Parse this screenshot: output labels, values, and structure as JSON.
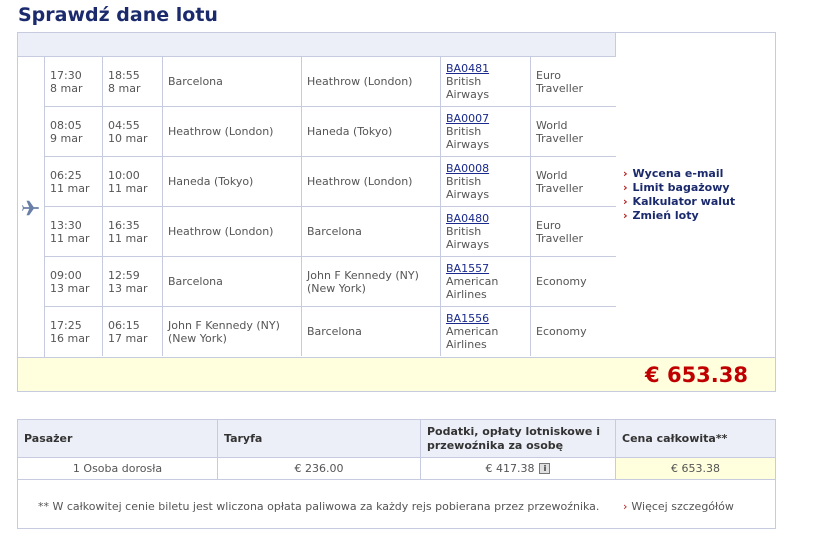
{
  "page_title": "Sprawdź dane lotu",
  "flights": [
    {
      "dep_time": "17:30",
      "dep_date": "8 mar",
      "arr_time": "18:55",
      "arr_date": "8 mar",
      "from": "Barcelona",
      "to": "Heathrow (London)",
      "flight_no": "BA0481",
      "airline": "British Airways",
      "cabin": "Euro Traveller"
    },
    {
      "dep_time": "08:05",
      "dep_date": "9 mar",
      "arr_time": "04:55",
      "arr_date": "10 mar",
      "from": "Heathrow (London)",
      "to": "Haneda (Tokyo)",
      "flight_no": "BA0007",
      "airline": "British Airways",
      "cabin": "World Traveller"
    },
    {
      "dep_time": "06:25",
      "dep_date": "11 mar",
      "arr_time": "10:00",
      "arr_date": "11 mar",
      "from": "Haneda (Tokyo)",
      "to": "Heathrow (London)",
      "flight_no": "BA0008",
      "airline": "British Airways",
      "cabin": "World Traveller"
    },
    {
      "dep_time": "13:30",
      "dep_date": "11 mar",
      "arr_time": "16:35",
      "arr_date": "11 mar",
      "from": "Heathrow (London)",
      "to": "Barcelona",
      "flight_no": "BA0480",
      "airline": "British Airways",
      "cabin": "Euro Traveller"
    },
    {
      "dep_time": "09:00",
      "dep_date": "13 mar",
      "arr_time": "12:59",
      "arr_date": "13 mar",
      "from": "Barcelona",
      "to": "John F Kennedy (NY) (New York)",
      "flight_no": "BA1557",
      "airline": "American Airlines",
      "cabin": "Economy"
    },
    {
      "dep_time": "17:25",
      "dep_date": "16 mar",
      "arr_time": "06:15",
      "arr_date": "17 mar",
      "from": "John F Kennedy (NY) (New York)",
      "to": "Barcelona",
      "flight_no": "BA1556",
      "airline": "American Airlines",
      "cabin": "Economy"
    }
  ],
  "side_links": [
    "Wycena e-mail",
    "Limit bagażowy",
    "Kalkulator walut",
    "Zmień loty"
  ],
  "total_price": "€ 653.38",
  "price_table": {
    "headers": [
      "Pasażer",
      "Taryfa",
      "Podatki, opłaty lotniskowe i przewoźnika za osobę",
      "Cena całkowita**"
    ],
    "row": [
      "1 Osoba dorosła",
      "€ 236.00",
      "€ 417.38",
      "€ 653.38"
    ],
    "info_glyph": "i"
  },
  "note": "** W całkowitej cenie biletu jest wliczona opłata paliwowa za każdy rejs pobierana przez przewoźnika.",
  "more_details": "Więcej szczegółów",
  "colors": {
    "title": "#1a2a6c",
    "header_bg": "#eceff8",
    "total_bg": "#ffffdd",
    "price": "#c00000",
    "border": "#c7cbe0"
  }
}
